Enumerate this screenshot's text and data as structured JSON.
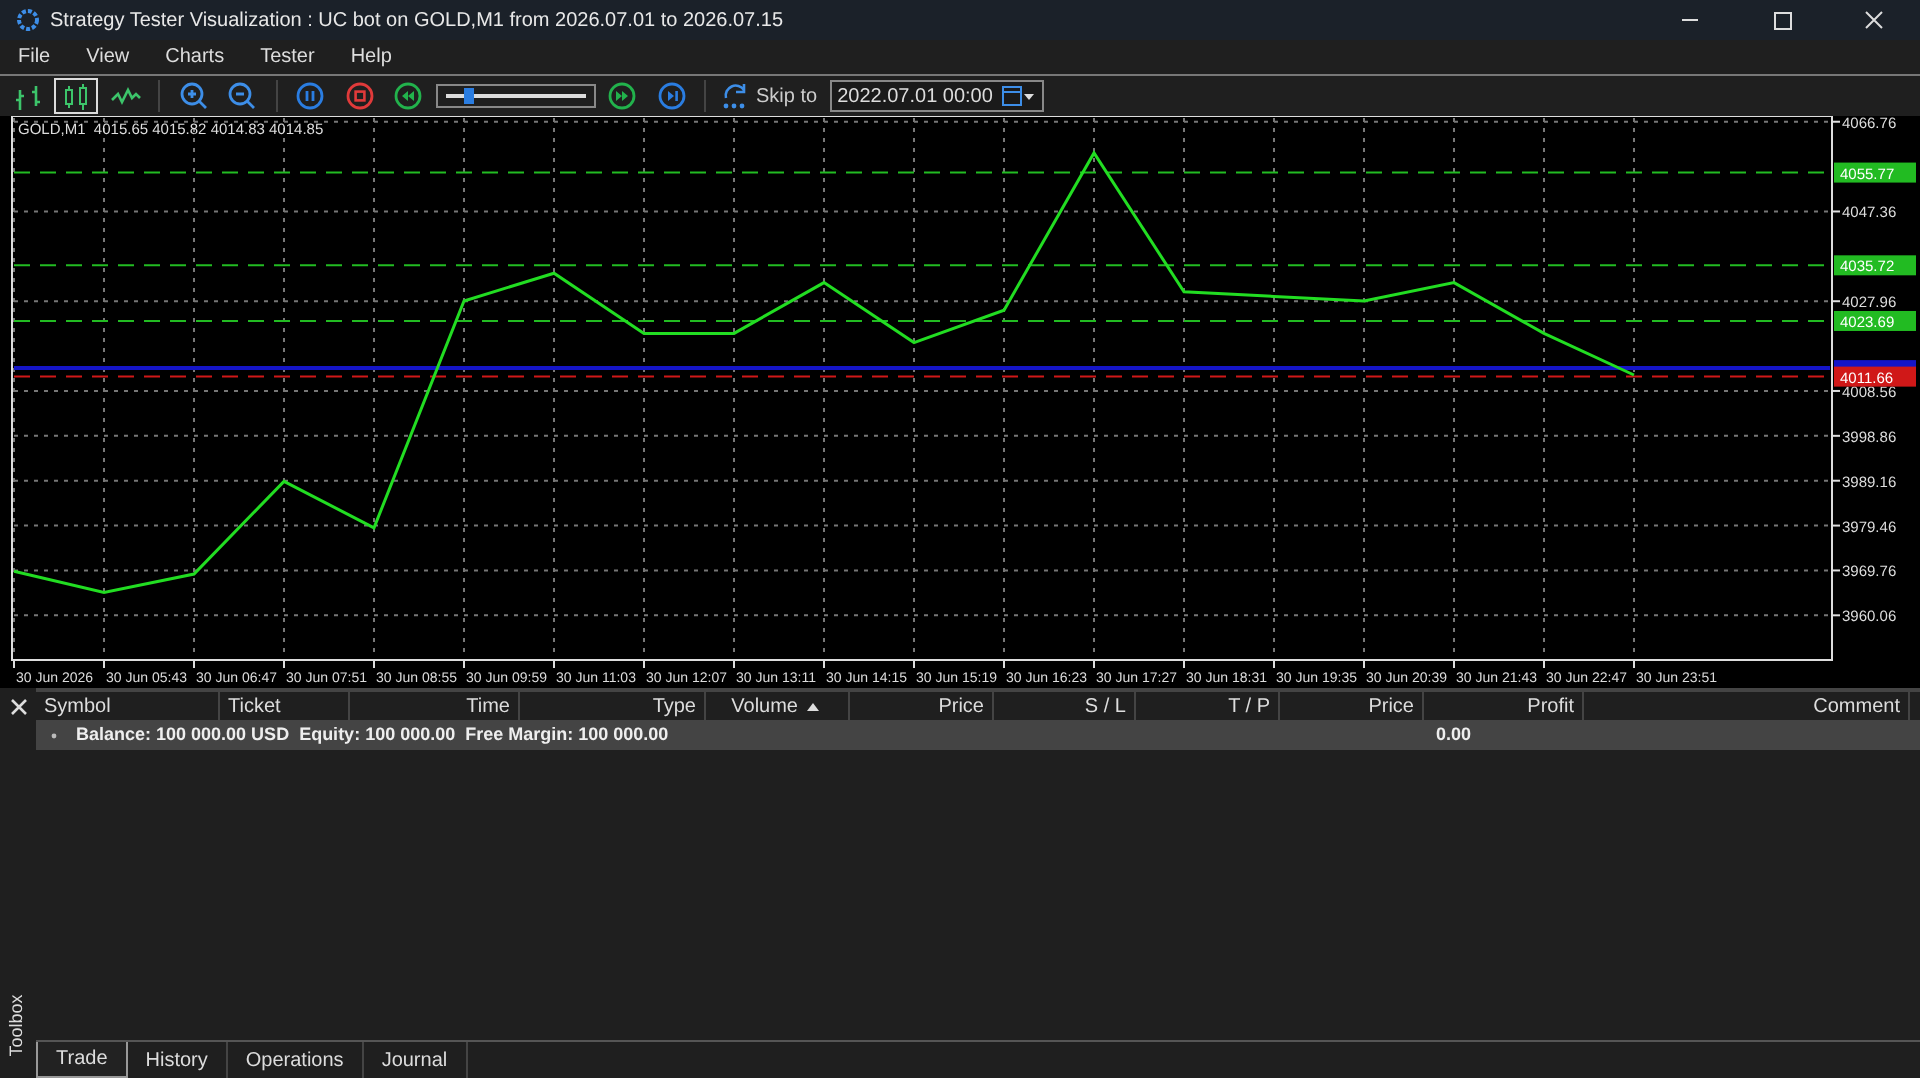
{
  "window": {
    "title": "Strategy Tester Visualization : UC bot on GOLD,M1 from 2026.07.01 to 2026.07.15"
  },
  "menu": [
    "File",
    "View",
    "Charts",
    "Tester",
    "Help"
  ],
  "toolbar": {
    "chart_modes": [
      {
        "kind": "bars",
        "selected": false
      },
      {
        "kind": "candles",
        "selected": true
      },
      {
        "kind": "line",
        "selected": false
      }
    ],
    "speed": {
      "level": 0.15
    },
    "skip_label": "Skip to",
    "skip_date": "2022.07.01 00:00"
  },
  "chart": {
    "header": "GOLD,M1  4015.65 4015.82 4014.83 4014.85",
    "chart_data": {
      "type": "line",
      "categories": [
        "30 Jun 2026",
        "30 Jun 05:43",
        "30 Jun 06:47",
        "30 Jun 07:51",
        "30 Jun 08:55",
        "30 Jun 09:59",
        "30 Jun 11:03",
        "30 Jun 12:07",
        "30 Jun 13:11",
        "30 Jun 14:15",
        "30 Jun 15:19",
        "30 Jun 16:23",
        "30 Jun 17:27",
        "30 Jun 18:31",
        "30 Jun 19:35",
        "30 Jun 20:39",
        "30 Jun 21:43",
        "30 Jun 22:47",
        "30 Jun 23:51"
      ],
      "series": [
        {
          "color": "#22dd22",
          "values": [
            3969.6,
            3965,
            3969,
            3989,
            3979,
            4028,
            4034,
            4021,
            4021,
            4032,
            4019,
            4026,
            4060,
            4030,
            4029,
            4028,
            4032,
            4021,
            4012
          ]
        }
      ],
      "ylim": [
        3950.4,
        4068
      ],
      "grid": true,
      "yticks": [
        {
          "value": 4066.76,
          "label": "4066.76"
        },
        {
          "value": 4047.36,
          "label": "4047.36"
        },
        {
          "value": 4027.96,
          "label": "4027.96"
        },
        {
          "value": 4008.56,
          "label": "4008.56"
        },
        {
          "value": 3998.86,
          "label": "3998.86"
        },
        {
          "value": 3989.16,
          "label": "3989.16"
        },
        {
          "value": 3979.46,
          "label": "3979.46"
        },
        {
          "value": 3969.76,
          "label": "3969.76"
        },
        {
          "value": 3960.06,
          "label": "3960.06"
        }
      ],
      "ref_lines": [
        {
          "axis": "y",
          "value": 4055.77,
          "label": "4055.77",
          "color": "#22bb22"
        },
        {
          "axis": "y",
          "value": 4035.72,
          "label": "4035.72",
          "color": "#22bb22"
        },
        {
          "axis": "y",
          "value": 4023.69,
          "label": "4023.69",
          "color": "#22bb22"
        },
        {
          "axis": "y",
          "value": 4013.5,
          "color": "#1515c8"
        },
        {
          "axis": "y",
          "value": 4011.66,
          "label": "4011.66",
          "color": "#d01818"
        }
      ]
    }
  },
  "table": {
    "columns": [
      {
        "label": "Symbol",
        "sorted": false
      },
      {
        "label": "Ticket",
        "sorted": false
      },
      {
        "label": "Time",
        "sorted": false
      },
      {
        "label": "Type",
        "sorted": false
      },
      {
        "label": "Volume",
        "sorted": true
      },
      {
        "label": "Price",
        "sorted": false
      },
      {
        "label": "S / L",
        "sorted": false
      },
      {
        "label": "T / P",
        "sorted": false
      },
      {
        "label": "Price",
        "sorted": false
      },
      {
        "label": "Profit",
        "sorted": false
      },
      {
        "label": "Comment",
        "sorted": false
      }
    ],
    "summary": {
      "text": "Balance: 100 000.00 USD  Equity: 100 000.00  Free Margin: 100 000.00",
      "profit": "0.00"
    }
  },
  "side_label": "Toolbox",
  "tabs": [
    {
      "label": "Trade",
      "selected": true
    },
    {
      "label": "History",
      "selected": false
    },
    {
      "label": "Operations",
      "selected": false
    },
    {
      "label": "Journal",
      "selected": false
    }
  ]
}
